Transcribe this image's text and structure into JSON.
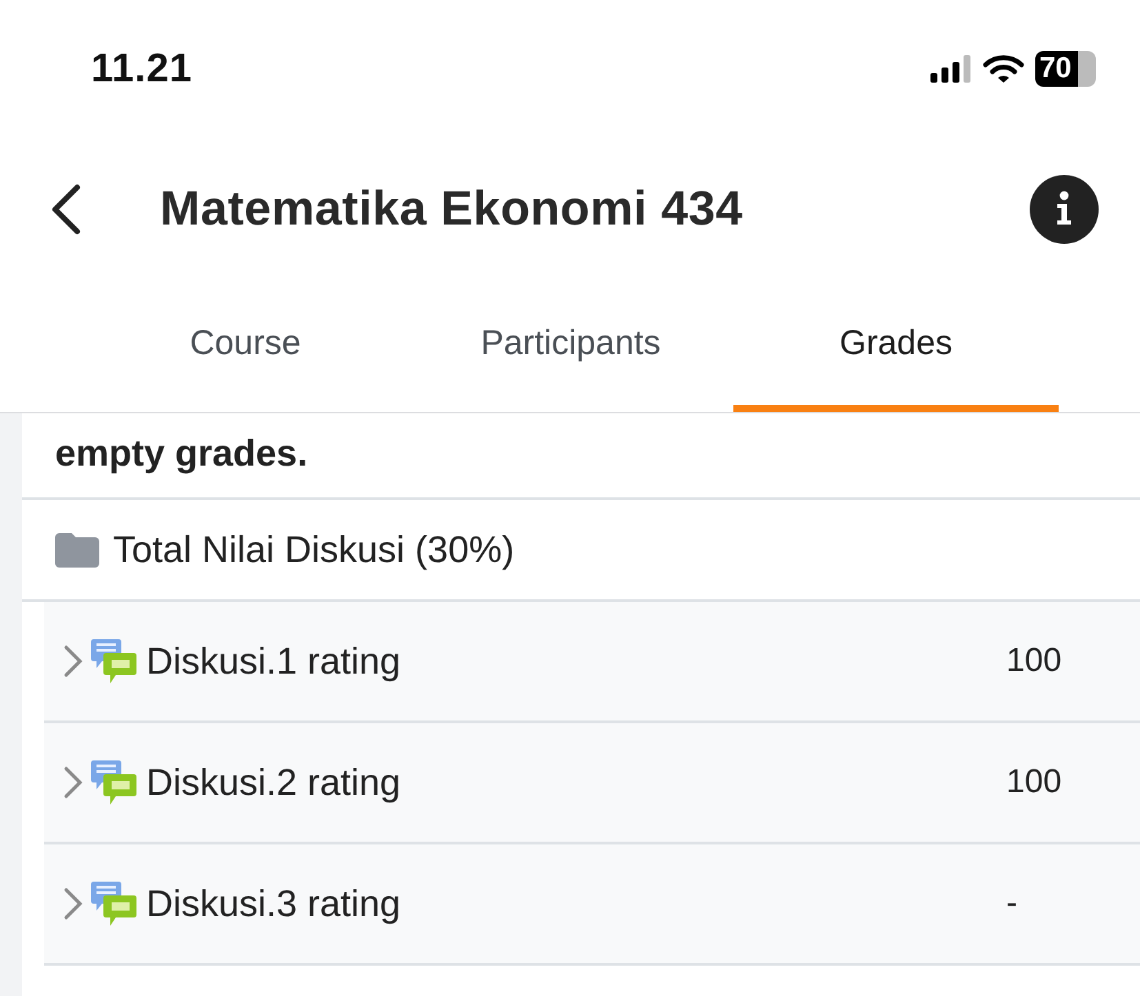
{
  "status_bar": {
    "time": "11.21",
    "battery": "70"
  },
  "header": {
    "title": "Matematika Ekonomi 434"
  },
  "tabs": [
    {
      "label": "Course",
      "selected": false
    },
    {
      "label": "Participants",
      "selected": false
    },
    {
      "label": "Grades",
      "selected": true
    }
  ],
  "aggregation_note": "empty grades.",
  "category": {
    "name": "Total Nilai Diskusi (30%)"
  },
  "items": [
    {
      "name": "Diskusi.1 rating",
      "grade": "100",
      "expanded": false
    },
    {
      "name": "Diskusi.2 rating",
      "grade": "100",
      "expanded": false
    },
    {
      "name": "Diskusi.3 rating",
      "grade": "-",
      "expanded": false
    }
  ]
}
